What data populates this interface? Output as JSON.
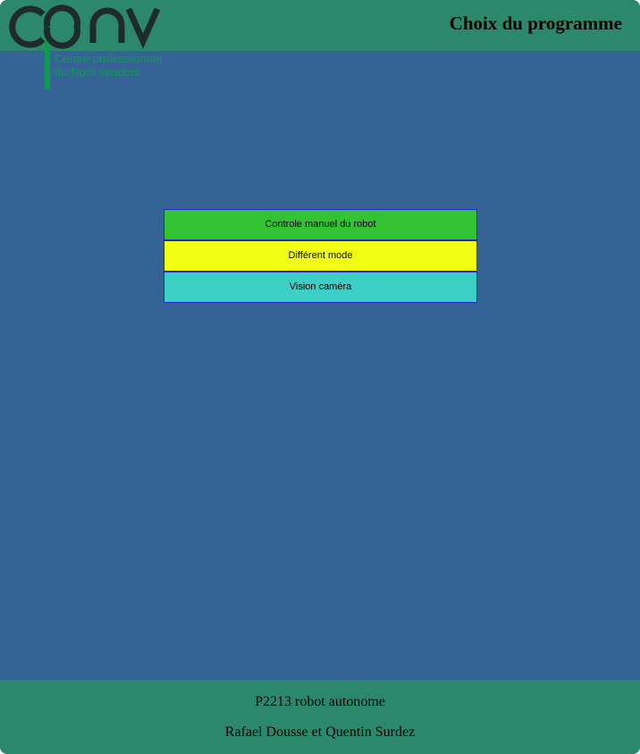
{
  "header": {
    "title": "Choix du programme"
  },
  "logo": {
    "letters": "cpnv",
    "tagline_line1": "Centre professionnel",
    "tagline_line2": "du Nord vaudois",
    "color_dark": "#1f2a2a",
    "color_green": "#0e9a4f"
  },
  "menu": {
    "buttons": [
      {
        "label": "Controle manuel du robot",
        "color": "#33c233"
      },
      {
        "label": "Différent mode",
        "color": "#f2ff15"
      },
      {
        "label": "Vision caméra",
        "color": "#3bcfc6"
      }
    ]
  },
  "footer": {
    "project": "P2213 robot autonome",
    "authors": "Rafael Dousse et Quentin Surdez"
  },
  "colors": {
    "background": "#366396",
    "header_footer": "#2b886a",
    "button_border": "#1f24d8"
  }
}
